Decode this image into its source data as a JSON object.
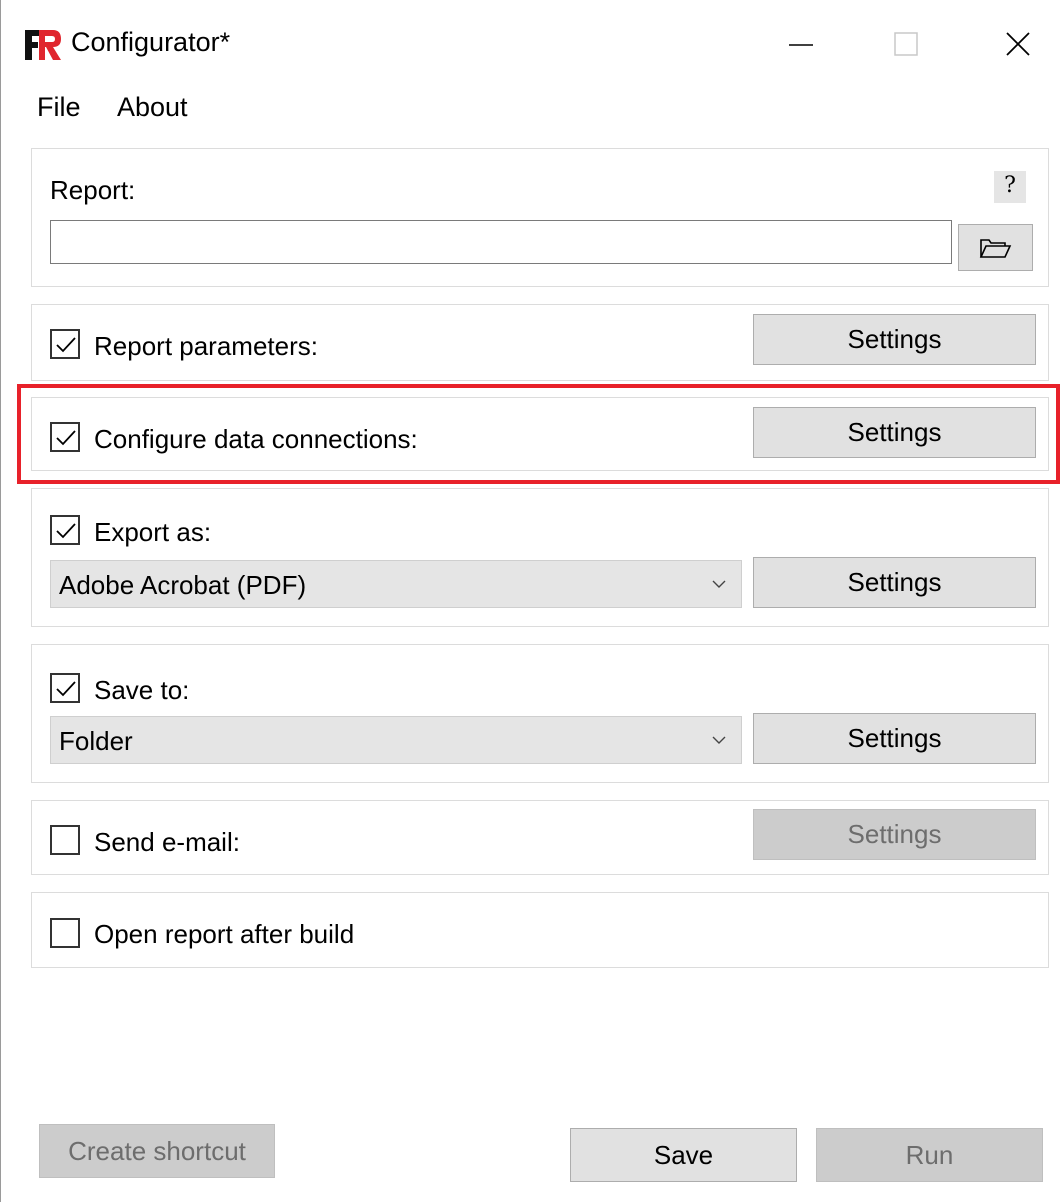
{
  "window": {
    "title": "Configurator*"
  },
  "menu": {
    "file": "File",
    "about": "About"
  },
  "report": {
    "label": "Report:",
    "help": "?",
    "path_value": ""
  },
  "params": {
    "label": "Report parameters:",
    "checked": true,
    "settings": "Settings"
  },
  "connections": {
    "label": "Configure data connections:",
    "checked": true,
    "settings": "Settings",
    "highlighted": true
  },
  "export": {
    "label": "Export as:",
    "checked": true,
    "format": "Adobe Acrobat (PDF)",
    "settings": "Settings"
  },
  "save_to": {
    "label": "Save to:",
    "checked": true,
    "destination": "Folder",
    "settings": "Settings"
  },
  "email": {
    "label": "Send e-mail:",
    "checked": false,
    "settings": "Settings",
    "settings_enabled": false
  },
  "open_after": {
    "label": "Open report after build",
    "checked": false
  },
  "footer": {
    "create_shortcut": "Create shortcut",
    "save": "Save",
    "run": "Run"
  },
  "colors": {
    "highlight": "#e8212a",
    "logo_red": "#e0262e",
    "button_bg": "#e1e1e1",
    "disabled_bg": "#cccccc"
  },
  "icons": {
    "logo": "fastreport-logo",
    "minimize": "minimize-icon",
    "maximize": "maximize-icon",
    "close": "close-icon",
    "browse": "folder-icon",
    "dropdown": "chevron-down-icon",
    "check": "checkmark-icon"
  }
}
